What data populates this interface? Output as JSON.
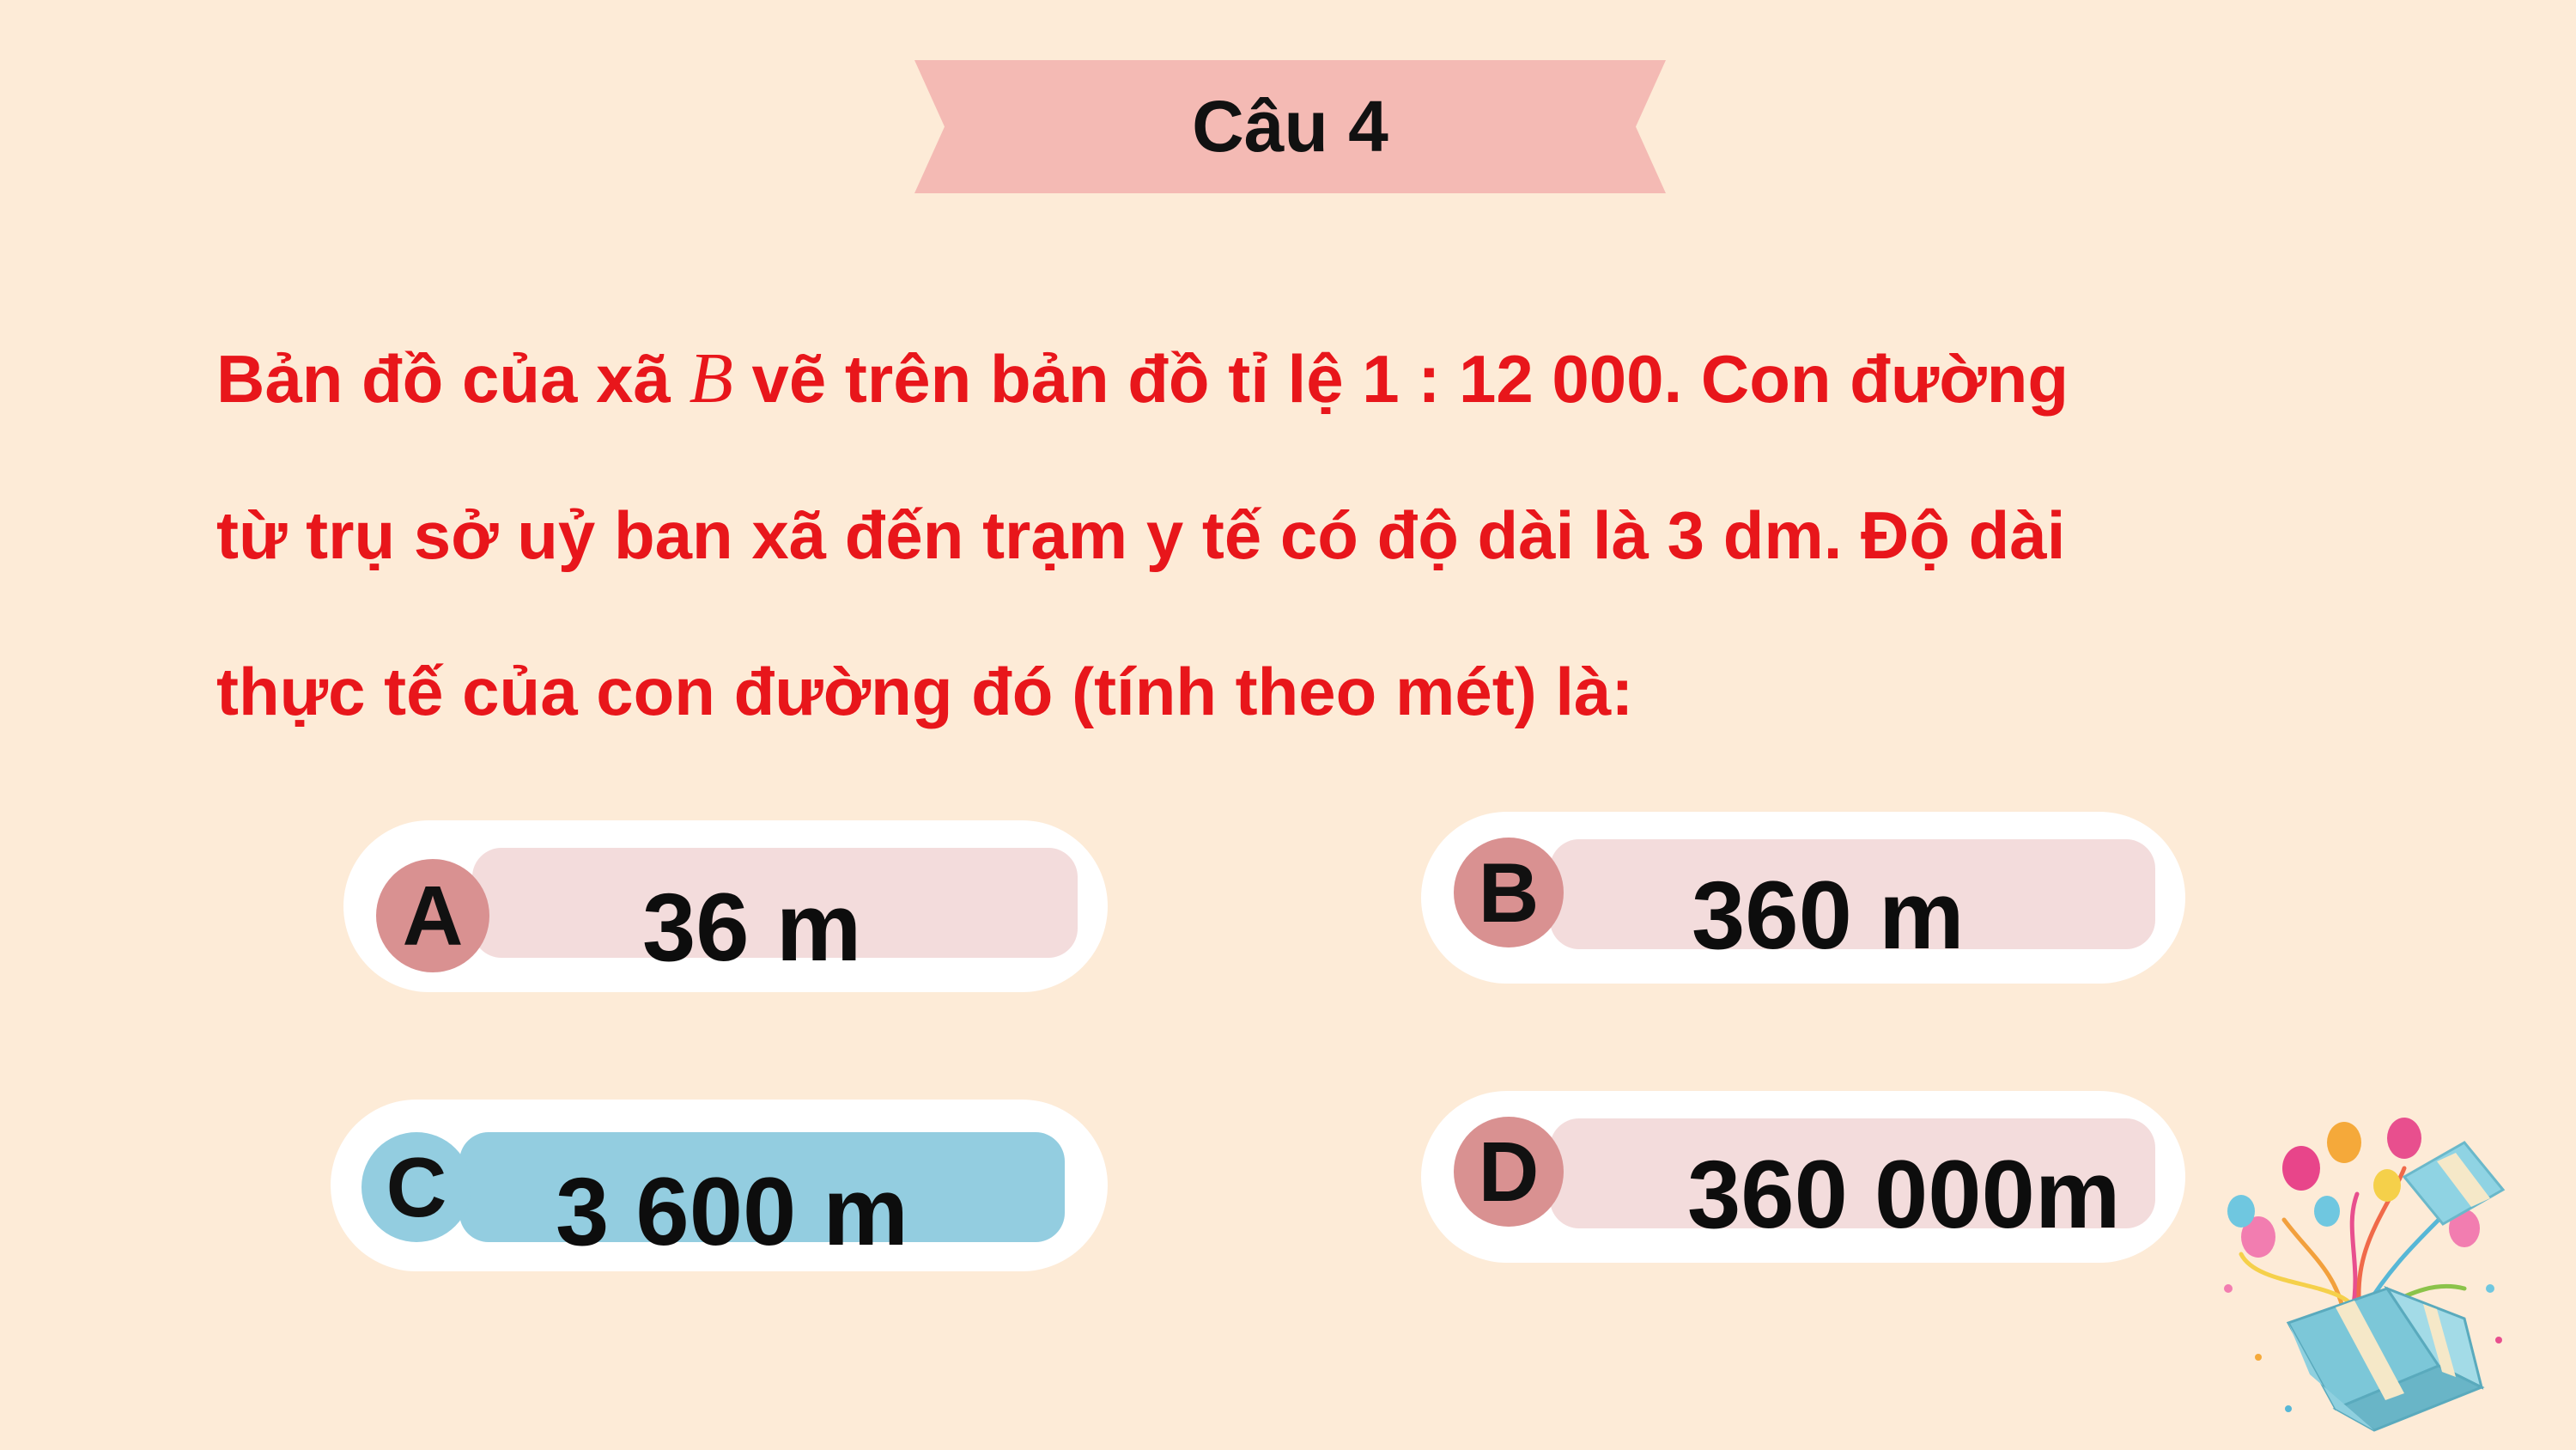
{
  "banner": {
    "title": "Câu 4"
  },
  "question": {
    "line1_pre": "Bản đồ của xã ",
    "line1_var": "B",
    "line1_post": " vẽ trên bản đồ tỉ lệ 1 : 12 000. Con đường",
    "line2": "từ trụ sở uỷ ban xã đến trạm y tế có độ dài là 3 dm. Độ dài",
    "line3": "thực tế của con đường đó (tính theo mét) là:"
  },
  "options": [
    {
      "letter": "A",
      "text": "36 m",
      "selected": false
    },
    {
      "letter": "B",
      "text": "360 m",
      "selected": false
    },
    {
      "letter": "C",
      "text": "3 600 m",
      "selected": true
    },
    {
      "letter": "D",
      "text": "360 000m",
      "selected": false
    }
  ],
  "colors": {
    "background": "#fdebd7",
    "banner": "#f4bab4",
    "question_text": "#e8161b",
    "option_bar": "#f3dcdc",
    "option_circle": "#d99191",
    "selected_bar": "#93cde0",
    "selected_circle": "#93cde0"
  },
  "decoration": {
    "icon": "gift-box-balloons-icon"
  }
}
